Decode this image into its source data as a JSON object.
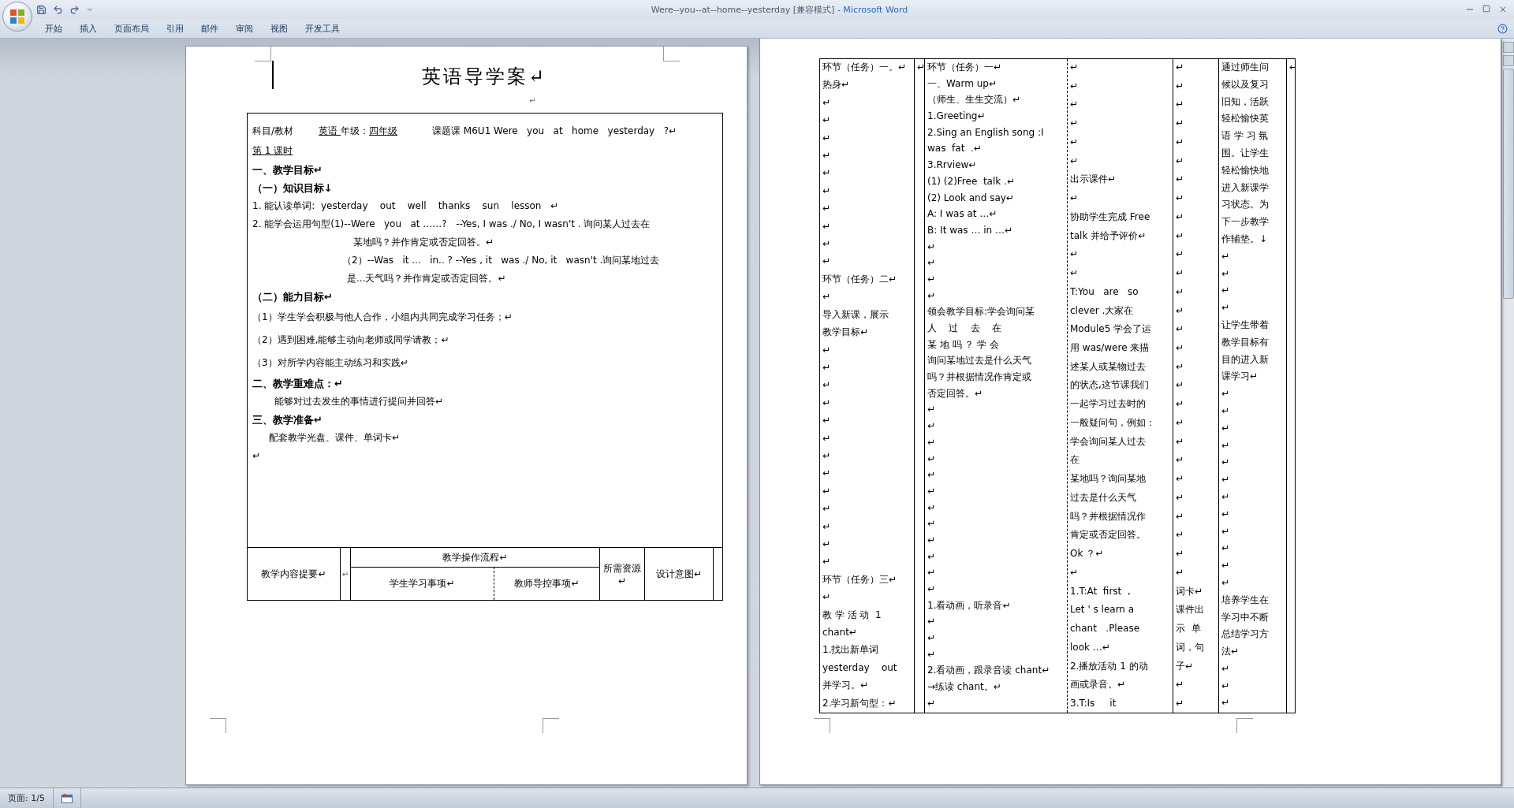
{
  "window": {
    "document_title": "Were--you--at--home--yesterday [兼容模式] - ",
    "app_title": "Microsoft Word"
  },
  "ribbon_tabs": [
    {
      "label": "开始",
      "selected": false
    },
    {
      "label": "插入",
      "selected": false
    },
    {
      "label": "页面布局",
      "selected": false
    },
    {
      "label": "引用",
      "selected": false
    },
    {
      "label": "邮件",
      "selected": false
    },
    {
      "label": "审阅",
      "selected": false
    },
    {
      "label": "视图",
      "selected": false
    },
    {
      "label": "开发工具",
      "selected": false
    }
  ],
  "left_page": {
    "title": "英语导学案↵",
    "blank": "↵",
    "info": {
      "subject_label": "科目/教材",
      "subject": "英语",
      "grade_label": "年级：",
      "grade": "四年级",
      "topic": "课题课 M6U1 Were   you   at   home   yesterday   ?↵",
      "lesson": "第 1 课时"
    },
    "paragraphs": [
      {
        "kind": "heading",
        "text": "一、教学目标↵"
      },
      {
        "kind": "heading",
        "text": "（一）知识目标↓"
      },
      {
        "kind": "item",
        "text": "1. 能认读单词:  yesterday    out    well    thanks    sun    lesson   ↵"
      },
      {
        "kind": "item",
        "text": "2. 能学会运用句型(1)--Were   you   at ……?   --Yes, I was ./ No, I wasn't . 询问某人过去在"
      },
      {
        "kind": "wrap",
        "text": "某地吗？并作肯定或否定回答。↵"
      },
      {
        "kind": "case",
        "text": "（2）--Was   it ...   in.. ? --Yes , it   was ./ No, it   wasn't .询问某地过去"
      },
      {
        "kind": "case-wrap",
        "text": "是...天气吗？并作肯定或否定回答。↵"
      },
      {
        "kind": "heading",
        "text": "（二）能力目标↵"
      },
      {
        "kind": "ability",
        "text": "（1）学生学会积极与他人合作，小组内共同完成学习任务；↵"
      },
      {
        "kind": "ability",
        "text": "（2）遇到困难,能够主动向老师或同学请教；↵"
      },
      {
        "kind": "ability",
        "text": "（3）对所学内容能主动练习和实践↵"
      },
      {
        "kind": "heading",
        "text": "二、教学重难点：↵"
      },
      {
        "kind": "detail",
        "text": "能够对过去发生的事情进行提问并回答↵"
      },
      {
        "kind": "heading",
        "text": "三、教学准备↵"
      },
      {
        "kind": "detail-alt",
        "text": "配套教学光盘、课件、单词卡↵"
      },
      {
        "kind": "item",
        "text": "↵"
      }
    ],
    "flow_header": {
      "content": "教学内容提要↵",
      "spacer": "↵",
      "process": "教学操作流程↵",
      "student": "学生学习事项↵",
      "teacher": "教师导控事项↵",
      "resources": "所需资源↵",
      "intent": "设计意图↵"
    }
  },
  "right_page": {
    "columns": [
      {
        "lines": [
          "环节（任务）一。↵",
          "热身↵",
          "↵",
          "↵",
          "↵",
          "↵",
          "↵",
          "↵",
          "↵",
          "↵",
          "↵",
          "↵",
          "环节（任务）二↵",
          "↵",
          "导入新课，展示",
          "教学目标↵",
          "↵",
          "↵",
          "↵",
          "↵",
          "↵",
          "↵",
          "↵",
          "↵",
          "↵",
          "↵",
          "↵",
          "↵",
          "↵",
          "环节（任务）三↵",
          "↵",
          "教 学 活 动  1",
          "chant↵",
          "1.找出新单词",
          "yesterday    out",
          "并学习。↵",
          "2.学习新句型：↵"
        ]
      },
      {
        "lines": [
          "↵"
        ]
      },
      {
        "lines": [
          "环节（任务）一↵",
          "一、Warm up↵",
          "（师生、生生交流）↵",
          "1.Greeting↵",
          "2.Sing an English song :I",
          "was  fat  .↵",
          "3.Rrview↵",
          "(1) (2)Free  talk .↵",
          "(2) Look and say↵",
          "A: I was at …↵",
          "B: It was … in …↵",
          "↵",
          "↵",
          "↵",
          "↵",
          "领会教学目标:学会询问某",
          "人    过    去    在",
          "某 地 吗 ？ 学 会",
          "询问某地过去是什么天气",
          "吗？并根据情况作肯定或",
          "否定回答。↵",
          "↵",
          "↵",
          "↵",
          "↵",
          "↵",
          "↵",
          "↵",
          "↵",
          "↵",
          "↵",
          "↵",
          "↵",
          "1.看动画，听录音↵",
          "↵",
          "↵",
          "↵",
          "2.看动画，跟录音读 chant↵",
          "→练读 chant。↵",
          "↵"
        ]
      },
      {
        "lines": [
          "↵",
          "↵",
          "↵",
          "↵",
          "↵",
          "↵",
          "出示课件↵",
          "↵",
          "协助学生完成 Free",
          "talk 并给予评价↵",
          "↵",
          "↵",
          "T:You   are   so",
          "clever .大家在",
          "Module5 学会了运",
          "用 was/were 来描",
          "述某人或某物过去",
          "的状态,这节课我们",
          "一起学习过去时的",
          "一般疑问句，例如：",
          "学会询问某人过去",
          "在",
          "某地吗？询问某地",
          "过去是什么天气",
          "吗？并根据情况作",
          "肯定或否定回答。",
          "Ok ？↵",
          "↵",
          "1.T:At  first  ,",
          "Let ' s learn a",
          "chant   .Please",
          "look …↵",
          "2.播放活动 1 的动",
          "画或录音。↵",
          "3.T:Is     it"
        ]
      },
      {
        "lines": [
          "↵",
          "↵",
          "↵",
          "↵",
          "↵",
          "↵",
          "↵",
          "↵",
          "↵",
          "↵",
          "↵",
          "↵",
          "↵",
          "↵",
          "↵",
          "↵",
          "↵",
          "↵",
          "↵",
          "↵",
          "↵",
          "↵",
          "↵",
          "↵",
          "↵",
          "↵",
          "↵",
          "↵",
          "词卡↵",
          "课件出",
          "示  单",
          "词，句",
          "子↵",
          "↵",
          "↵"
        ]
      },
      {
        "lines": [
          "通过师生问",
          "候以及复习",
          "旧知，活跃",
          "轻松愉快英",
          "语 学 习 氛",
          "围。让学生",
          "轻松愉快地",
          "进入新课学",
          "习状态。为",
          "下一步教学",
          "作辅垫。↓",
          "↵",
          "↵",
          "↵",
          "↵",
          "让学生带着",
          "教学目标有",
          "目的进入新",
          "课学习↵",
          "↵",
          "↵",
          "↵",
          "↵",
          "↵",
          "↵",
          "↵",
          "↵",
          "↵",
          "↵",
          "↵",
          "↵",
          "培养学生在",
          "学习中不断",
          "总结学习方",
          "法↵",
          "↵",
          "↵",
          "↵"
        ]
      },
      {
        "lines": [
          "↵"
        ]
      }
    ]
  },
  "status_bar": {
    "page": "页面: 1/5"
  }
}
